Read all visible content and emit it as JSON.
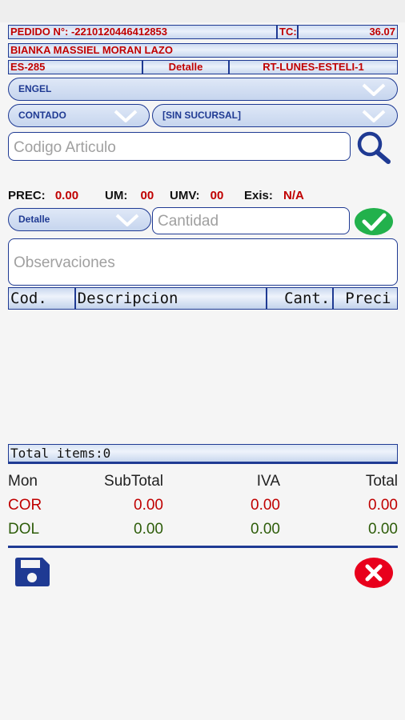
{
  "header": {
    "pedido_label": "PEDIDO N°: -2210120446412853",
    "tc_label": "TC:",
    "tc_value": "36.07",
    "client_name": "BIANKA MASSIEL MORAN LAZO",
    "code": "ES-285",
    "type": "Detalle",
    "route": "RT-LUNES-ESTELI-1"
  },
  "selectors": {
    "brand": "ENGEL",
    "payment": "CONTADO",
    "branch": "[SIN SUCURSAL]",
    "price_type": "Detalle"
  },
  "search": {
    "placeholder": "Codigo Articulo"
  },
  "info": {
    "prec_label": "PREC:",
    "prec_value": "0.00",
    "um_label": "UM:",
    "um_value": "00",
    "umv_label": "UMV:",
    "umv_value": "00",
    "exis_label": "Exis:",
    "exis_value": "N/A"
  },
  "quantity": {
    "placeholder": "Cantidad"
  },
  "observations": {
    "placeholder": "Observaciones"
  },
  "grid": {
    "columns": [
      "Cod.",
      "Descripcion",
      "Cant.",
      "Preci"
    ]
  },
  "total_items": "Total items:0",
  "summary": {
    "headers": [
      "Mon",
      "SubTotal",
      "IVA",
      "Total"
    ],
    "rows": [
      {
        "mon": "COR",
        "subtotal": "0.00",
        "iva": "0.00",
        "total": "0.00"
      },
      {
        "mon": "DOL",
        "subtotal": "0.00",
        "iva": "0.00",
        "total": "0.00"
      }
    ]
  },
  "colors": {
    "accent": "#1f3a93",
    "red": "#c00000",
    "green": "#2e5d0a",
    "confirm": "#22b14c",
    "cancel": "#e8001c"
  },
  "icons": {
    "search": "search-icon",
    "confirm": "check-icon",
    "save": "save-icon",
    "cancel": "close-icon"
  }
}
